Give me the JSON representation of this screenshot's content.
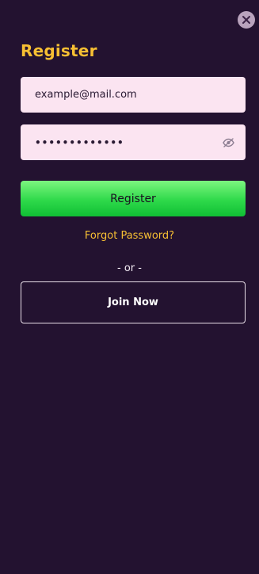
{
  "colors": {
    "background": "#231230",
    "accent": "#f7bf33",
    "field_background": "#fbe4f1",
    "primary_button": "#2ed94a"
  },
  "close": {
    "icon": "close-icon"
  },
  "form": {
    "title": "Register",
    "email": {
      "value": "example@mail.com"
    },
    "password": {
      "masked_value": "•••••••••••••",
      "toggle_icon": "eye-slash-icon"
    },
    "submit_label": "Register",
    "forgot_label": "Forgot Password?",
    "divider_label": "- or -",
    "join_label": "Join Now"
  }
}
